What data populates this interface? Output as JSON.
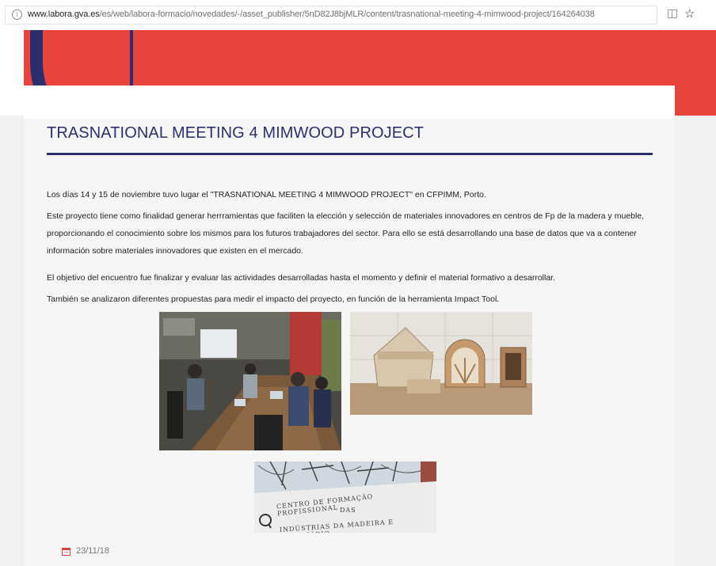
{
  "browser": {
    "url_domain": "www.labora.gva.es",
    "url_path": "/es/web/labora-formacio/novedades/-/asset_publisher/5nD82J8bjMLR/content/trasnational-meeting-4-mimwood-project/164264038",
    "icons": [
      "info-icon",
      "reader-view-icon",
      "bookmark-star-icon"
    ]
  },
  "article": {
    "title": "TRASNATIONAL MEETING 4 MIMWOOD PROJECT",
    "paragraphs": [
      "Los días 14 y 15 de noviembre tuvo lugar el \"TRASNATIONAL MEETING 4 MIMWOOD PROJECT\" en CFPIMM, Porto.",
      "Este proyecto tiene como finalidad generar herrramientas que faciliten la elección y selección de materiales innovadores en centros de Fp de la madera y mueble, proporcionando el conocimiento sobre los mismos para los futuros trabajadores del sector. Para ello se está desarrollando una base de datos que va a contener información sobre materiales innovadores que existen en el mercado.",
      "El objetivo del encuentro fue finalizar y evaluar las actividades desarrolladas hasta el momento y definir el material formativo a desarrollar.",
      "También se analizaron diferentes propuestas para medir el impacto del proyecto, en función de la herramienta Impact Tool."
    ],
    "photo_sign": {
      "line1": "CENTRO DE FORMAÇÃO PROFISSIONAL",
      "line2": "DAS",
      "line3": "INDÚSTRIAS DA MADEIRA E MOBILIÁRIO"
    },
    "date": "23/11/18",
    "date_icon": "calendar-icon"
  },
  "colors": {
    "hero_red": "#e8443b",
    "navy": "#2b2f70",
    "card_bg": "#f6f6f6"
  }
}
